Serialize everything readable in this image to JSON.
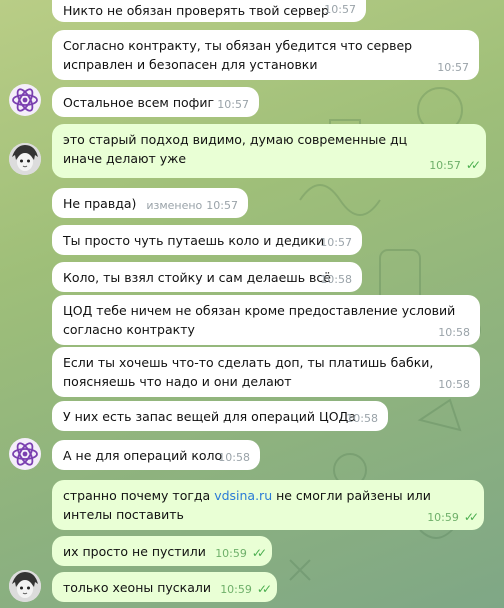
{
  "messages": [
    {
      "id": "m1",
      "side": "in",
      "text": "Никто не обязан проверять твой сервер",
      "time": "10:57"
    },
    {
      "id": "m2",
      "side": "in",
      "text": "Согласно контракту, ты обязан убедится что сервер исправлен и безопасен для установки",
      "time": "10:57"
    },
    {
      "id": "m3",
      "side": "in",
      "text": "Остальное всем пофиг",
      "time": "10:57"
    },
    {
      "id": "m4",
      "side": "out",
      "text": "это старый подход видимо, думаю современные дц иначе делают уже",
      "time": "10:57"
    },
    {
      "id": "m5",
      "side": "in",
      "text": "Не правда)",
      "edited": "изменено",
      "time": "10:57"
    },
    {
      "id": "m6",
      "side": "in",
      "text": "Ты просто чуть путаешь коло и дедики",
      "time": "10:57"
    },
    {
      "id": "m7",
      "side": "in",
      "text": "Коло, ты взял стойку и сам делаешь всё",
      "time": "10:58"
    },
    {
      "id": "m8",
      "side": "in",
      "text": "ЦОД тебе ничем не обязан кроме предоставление условий согласно контракту",
      "time": "10:58"
    },
    {
      "id": "m9",
      "side": "in",
      "text": "Если ты хочешь что-то сделать доп, ты платишь бабки, поясняешь что надо и они делают",
      "time": "10:58"
    },
    {
      "id": "m10",
      "side": "in",
      "text": "У них есть запас вещей для операций ЦОДа",
      "time": "10:58"
    },
    {
      "id": "m11",
      "side": "in",
      "text": "А не для операций коло",
      "time": "10:58"
    },
    {
      "id": "m12",
      "side": "out",
      "text_before": "странно почему тогда ",
      "link": "vdsina.ru",
      "text_after": " не смогли райзены или интелы поставить",
      "time": "10:59"
    },
    {
      "id": "m13",
      "side": "out",
      "text": "их просто не пустили",
      "time": "10:59"
    },
    {
      "id": "m14",
      "side": "out",
      "text": "только хеоны пускали",
      "time": "10:59"
    }
  ],
  "read_ticks": "✓✓",
  "colors": {
    "incoming": "#ffffff",
    "outgoing": "#e9ffd5",
    "link": "#2a7bd6",
    "tick": "#4caf50"
  },
  "icons": {
    "atom_avatar": "atom-avatar-icon",
    "anime_avatar": "anime-avatar-icon",
    "read_receipt": "double-check-icon"
  }
}
